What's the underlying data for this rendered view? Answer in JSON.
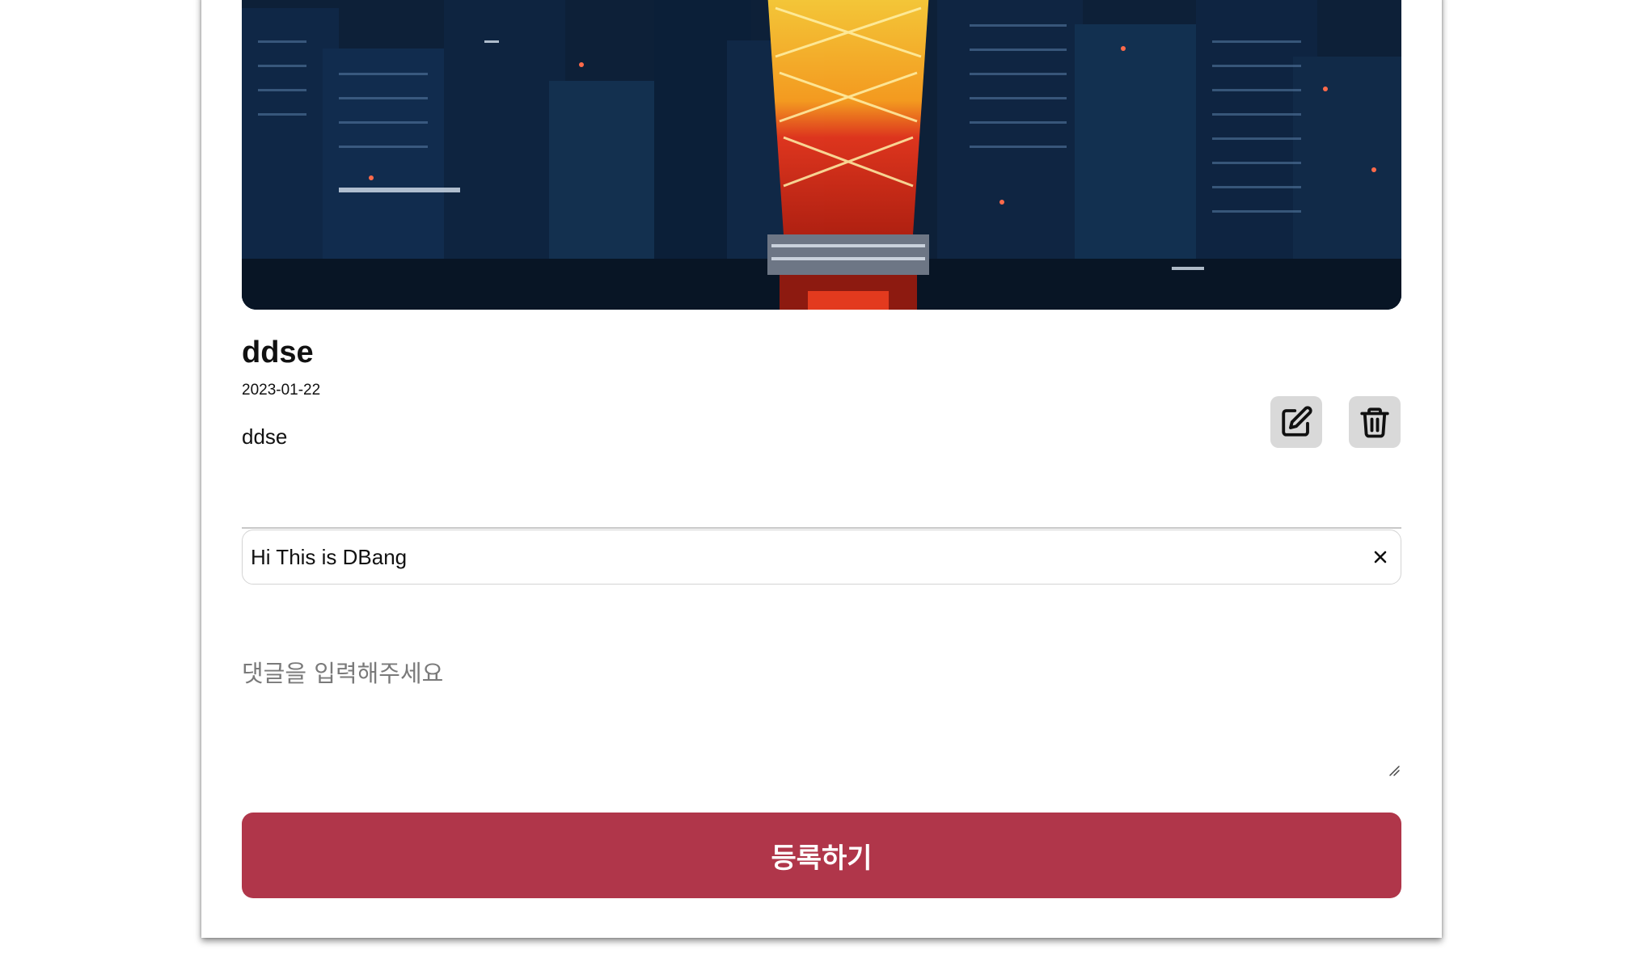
{
  "post": {
    "title": "ddse",
    "date": "2023-01-22",
    "content": "ddse"
  },
  "actions": {
    "edit_icon": "edit-icon",
    "delete_icon": "trash-icon"
  },
  "comments": [
    {
      "text": "Hi This is DBang",
      "remove_icon": "close-icon"
    }
  ],
  "comment_form": {
    "placeholder": "댓글을 입력해주세요",
    "submit_label": "등록하기"
  },
  "colors": {
    "accent": "#b0364a",
    "icon_button_bg": "#d9d9d9",
    "hero_sky": "#0c2140"
  }
}
